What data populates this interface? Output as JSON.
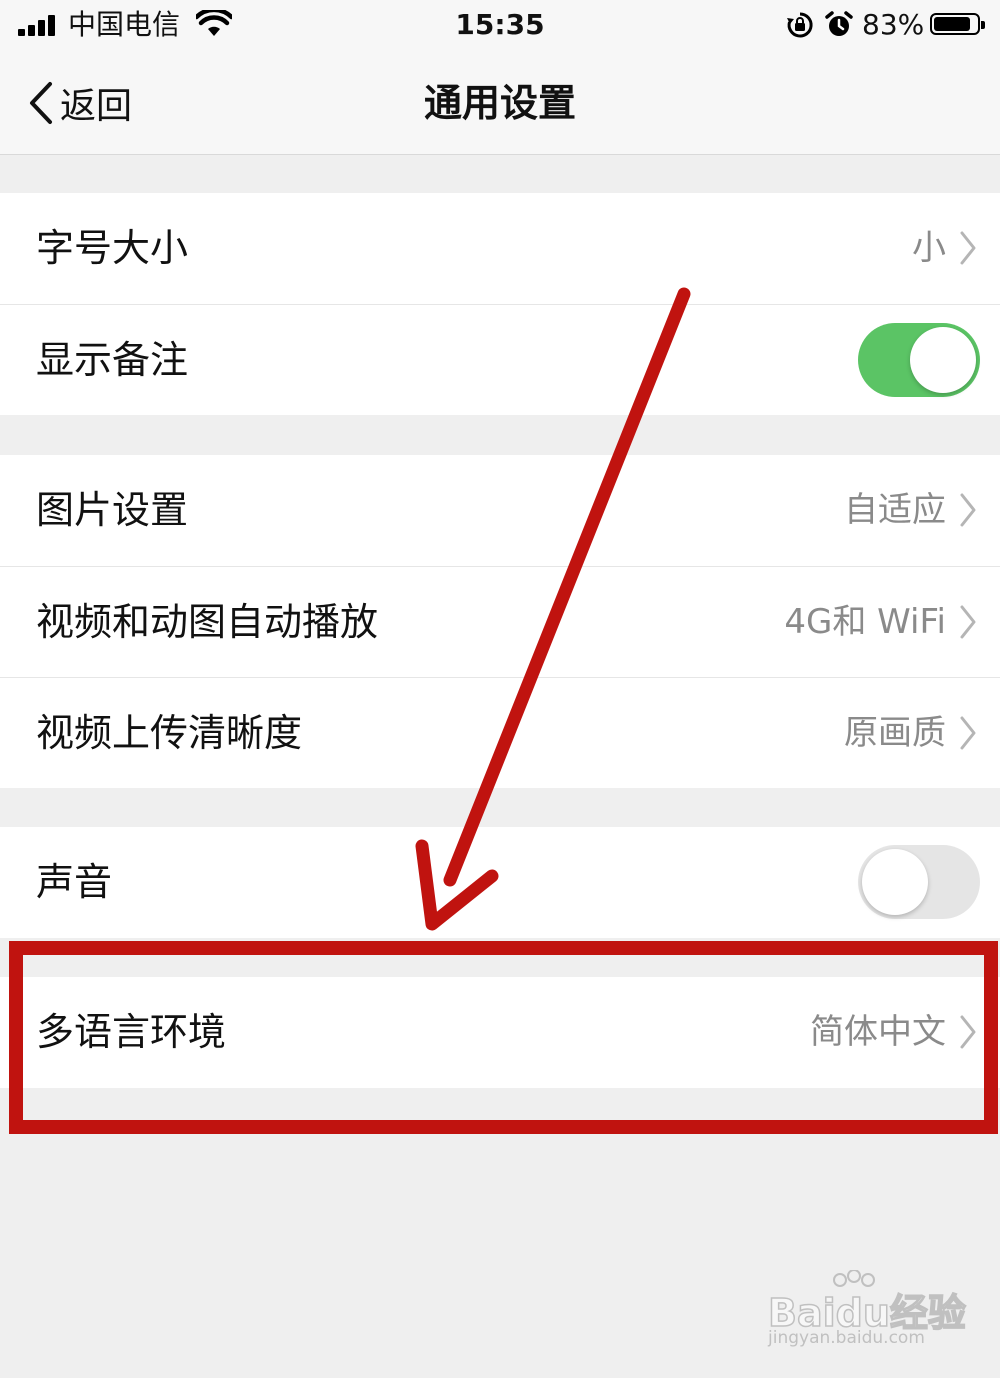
{
  "status_bar": {
    "carrier": "中国电信",
    "time": "15:35",
    "battery_percent": "83%",
    "icons": [
      "signal-icon",
      "wifi-icon",
      "rotation-lock-icon",
      "alarm-icon",
      "battery-icon"
    ]
  },
  "nav": {
    "back_label": "返回",
    "title": "通用设置"
  },
  "settings": {
    "font_size": {
      "label": "字号大小",
      "value": "小"
    },
    "show_remarks": {
      "label": "显示备注",
      "toggle": true
    },
    "image_settings": {
      "label": "图片设置",
      "value": "自适应"
    },
    "autoplay": {
      "label": "视频和动图自动播放",
      "value": "4G和 WiFi"
    },
    "upload_quality": {
      "label": "视频上传清晰度",
      "value": "原画质"
    },
    "sound": {
      "label": "声音",
      "toggle": false
    },
    "language": {
      "label": "多语言环境",
      "value": "简体中文"
    }
  },
  "colors": {
    "toggle_on": "#5bc465",
    "annotation_red": "#c0130f",
    "secondary_text": "#8a8a8a",
    "background": "#efefef"
  },
  "watermark": {
    "brand": "Baidu经验",
    "url": "jingyan.baidu.com"
  }
}
